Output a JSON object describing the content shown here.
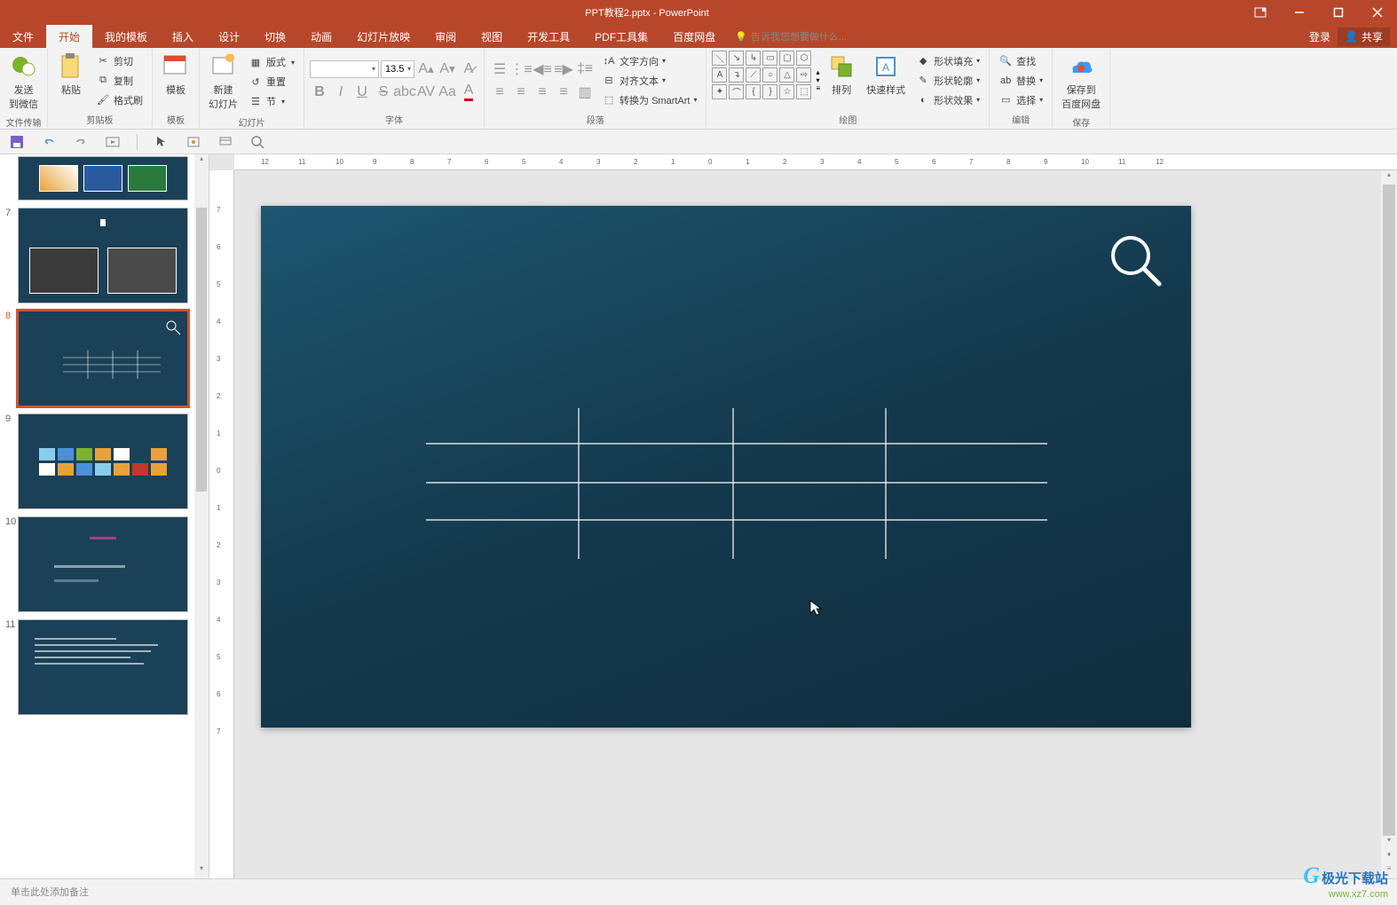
{
  "title": "PPT教程2.pptx - PowerPoint",
  "menu": {
    "file": "文件",
    "home": "开始",
    "templates": "我的模板",
    "insert": "插入",
    "design": "设计",
    "transitions": "切换",
    "animations": "动画",
    "slideshow": "幻灯片放映",
    "review": "审阅",
    "view": "视图",
    "developer": "开发工具",
    "pdf": "PDF工具集",
    "baidu": "百度网盘",
    "tellme": "告诉我您想要做什么...",
    "login": "登录",
    "share": "共享"
  },
  "ribbon": {
    "groups": {
      "fileTransfer": "文件传输",
      "clipboard": "剪贴板",
      "template": "模板",
      "slides": "幻灯片",
      "font": "字体",
      "paragraph": "段落",
      "drawing": "绘图",
      "editing": "编辑",
      "save": "保存"
    },
    "sendToWechat": "发送\n到微信",
    "paste": "粘贴",
    "cut": "剪切",
    "copy": "复制",
    "formatPainter": "格式刷",
    "templateBtn": "模板",
    "newSlide": "新建\n幻灯片",
    "layout": "版式",
    "reset": "重置",
    "section": "节",
    "fontName": "",
    "fontSize": "13.5",
    "textDirection": "文字方向",
    "alignText": "对齐文本",
    "convertSmartArt": "转换为 SmartArt",
    "arrange": "排列",
    "quickStyles": "快速样式",
    "shapeFill": "形状填充",
    "shapeOutline": "形状轮廓",
    "shapeEffects": "形状效果",
    "find": "查找",
    "replace": "替换",
    "select": "选择",
    "saveToBaidu": "保存到\n百度网盘"
  },
  "slides": {
    "num7": "7",
    "num8": "8",
    "num9": "9",
    "num10": "10",
    "num11": "11"
  },
  "notes": "单击此处添加备注",
  "watermark": {
    "name": "极光下载站",
    "url": "www.xz7.com"
  },
  "ruler_h": [
    "12",
    "11",
    "10",
    "9",
    "8",
    "7",
    "6",
    "5",
    "4",
    "3",
    "2",
    "1",
    "0",
    "1",
    "2",
    "3",
    "4",
    "5",
    "6",
    "7",
    "8",
    "9",
    "10",
    "11",
    "12"
  ],
  "ruler_v": [
    "7",
    "6",
    "5",
    "4",
    "3",
    "2",
    "1",
    "0",
    "1",
    "2",
    "3",
    "4",
    "5",
    "6",
    "7"
  ]
}
